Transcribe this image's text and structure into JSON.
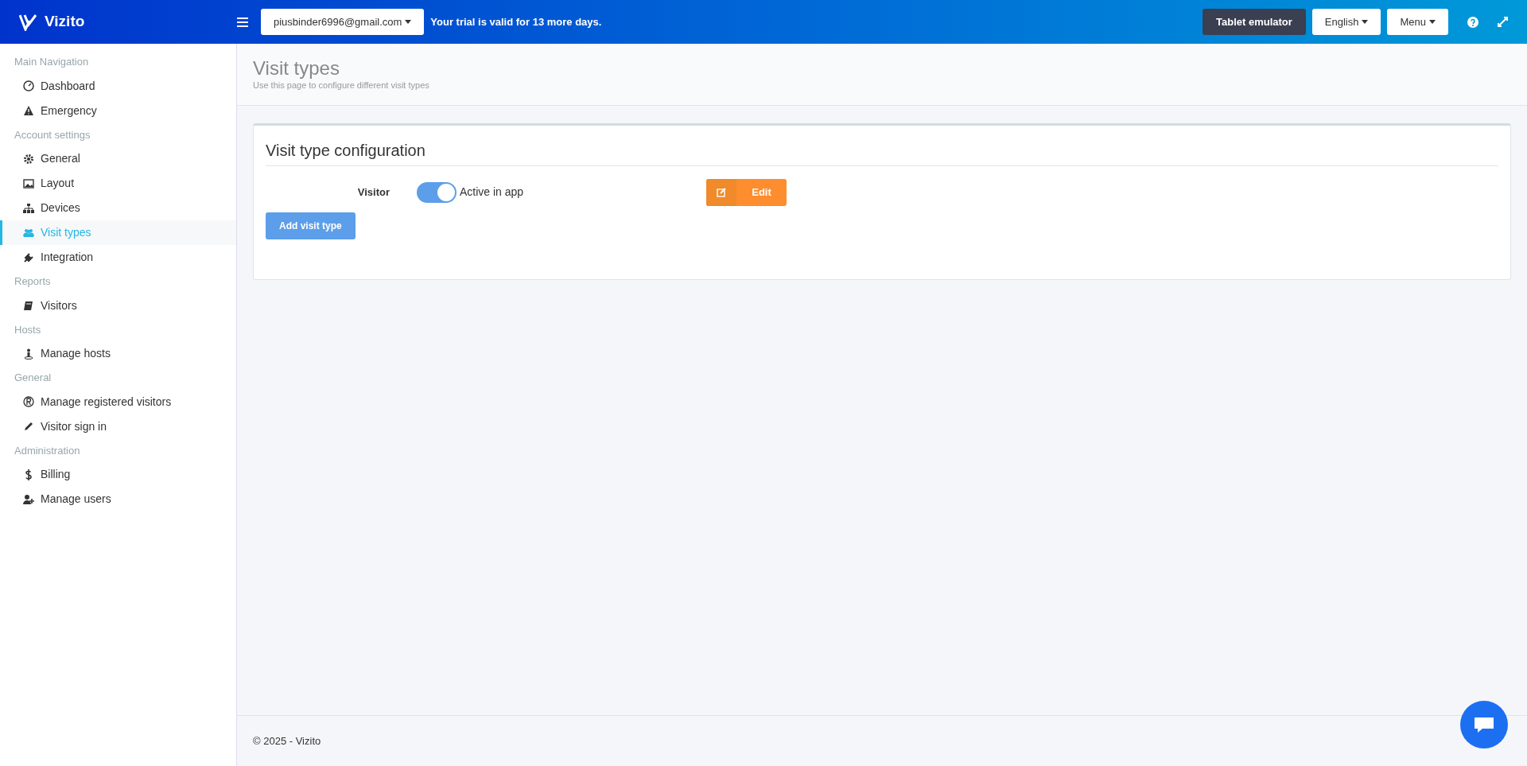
{
  "header": {
    "brand": "Vizito",
    "account": "piusbinder6996@gmail.com",
    "trial": "Your trial is valid for 13 more days.",
    "buttons": [
      {
        "label": "Tablet emulator",
        "kind": "dark"
      },
      {
        "label": "English",
        "kind": "dropdown"
      },
      {
        "label": "Menu",
        "kind": "dropdown"
      }
    ]
  },
  "sidebar": {
    "sections": [
      {
        "heading": "Main Navigation",
        "items": [
          {
            "label": "Dashboard",
            "selected": false
          },
          {
            "label": "Emergency",
            "selected": false
          }
        ]
      },
      {
        "heading": "Account settings",
        "items": [
          {
            "label": "General",
            "selected": false
          },
          {
            "label": "Layout",
            "selected": false
          },
          {
            "label": "Devices",
            "selected": false
          },
          {
            "label": "Visit types",
            "selected": true
          },
          {
            "label": "Integration",
            "selected": false
          }
        ]
      },
      {
        "heading": "Reports",
        "items": [
          {
            "label": "Visitors",
            "selected": false
          }
        ]
      },
      {
        "heading": "Hosts",
        "items": [
          {
            "label": "Manage hosts",
            "selected": false
          }
        ]
      },
      {
        "heading": "General",
        "items": [
          {
            "label": "Manage registered visitors",
            "selected": false
          },
          {
            "label": "Visitor sign in",
            "selected": false
          }
        ]
      },
      {
        "heading": "Administration",
        "items": [
          {
            "label": "Billing",
            "selected": false
          },
          {
            "label": "Manage users",
            "selected": false
          }
        ]
      }
    ]
  },
  "page": {
    "title": "Visit types",
    "subtitle": "Use this page to configure different visit types"
  },
  "card": {
    "title": "Visit type configuration",
    "visit_types": [
      {
        "name": "Visitor",
        "on": true,
        "toggle_label": "Active in app",
        "edit": "Edit"
      }
    ],
    "add_button": "Add visit type"
  },
  "footer": "© 2025 - Vizito"
}
